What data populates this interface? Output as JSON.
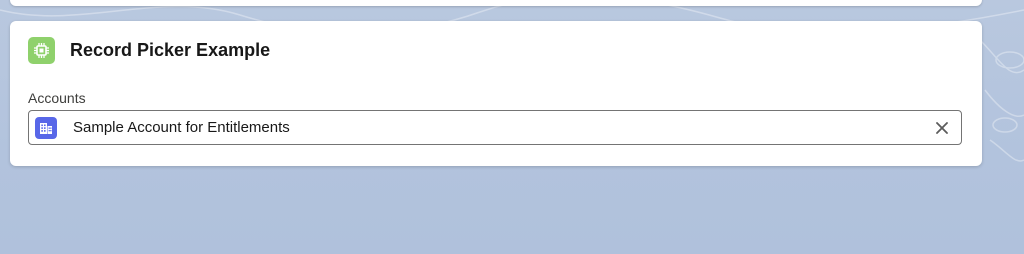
{
  "card": {
    "title": "Record Picker Example",
    "header_icon": "component-chip-icon",
    "header_icon_color": "#8fd16c"
  },
  "field": {
    "label": "Accounts",
    "value": "Sample Account for Entitlements",
    "object_icon": "account-building-icon",
    "object_icon_color": "#5867e8",
    "clear_icon": "close-icon"
  },
  "colors": {
    "background": "#b2c3dd",
    "card": "#ffffff",
    "border": "#747474"
  }
}
